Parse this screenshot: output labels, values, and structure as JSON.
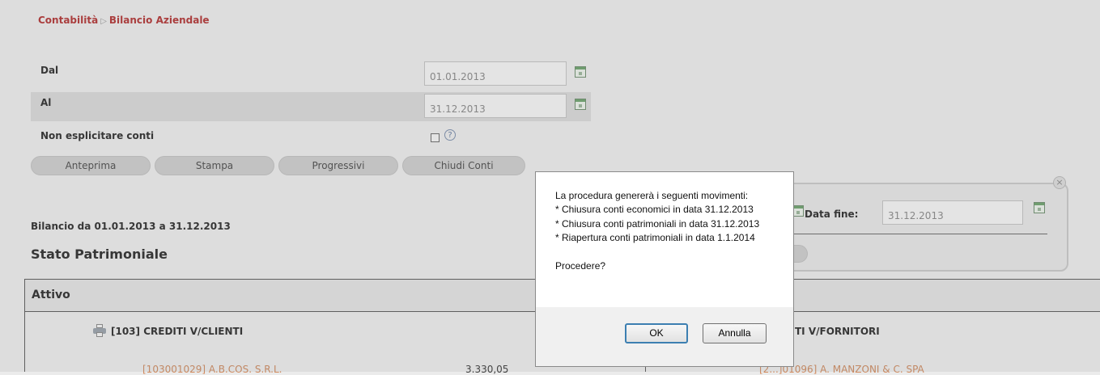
{
  "breadcrumb": {
    "root": "Contabilità",
    "separator": "▷",
    "current": "Bilancio Aziendale"
  },
  "form": {
    "dal_label": "Dal",
    "dal_value": "01.01.2013",
    "al_label": "Al",
    "al_value": "31.12.2013",
    "non_esplicitare_label": "Non esplicitare conti",
    "non_esplicitare_checked": false,
    "help_glyph": "?"
  },
  "buttons": {
    "anteprima": "Anteprima",
    "stampa": "Stampa",
    "progressivi": "Progressivi",
    "chiudi_conti": "Chiudi Conti"
  },
  "report": {
    "range_title": "Bilancio da 01.01.2013 a 31.12.2013",
    "section_title": "Stato Patrimoniale",
    "column_header": "Attivo",
    "left_account_head": "[103] CREDITI V/CLIENTI",
    "left_account_line": "[103001029] A.B.COS. S.R.L.",
    "left_amount": "3.330,05",
    "right_account_head": "TI V/FORNITORI",
    "right_account_line": "[2...]01096] A. MANZONI & C. SPA"
  },
  "side_popup": {
    "data_fine_label": "Data fine:",
    "data_fine_value": "31.12.2013",
    "close_glyph": "×"
  },
  "dialog": {
    "lines": [
      "La procedura genererà i seguenti movimenti:",
      "* Chiusura conti economici in data 31.12.2013",
      "* Chiusura conti patrimoniali in data 31.12.2013",
      "* Riapertura conti patrimoniali in data 1.1.2014",
      "",
      "Procedere?"
    ],
    "ok_label": "OK",
    "cancel_label": "Annulla"
  },
  "colors": {
    "breadcrumb": "#b52b2b",
    "account_link": "#d38a5c",
    "ok_focus": "#3c7fb1"
  },
  "icons": {
    "calendar": "calendar-icon",
    "help": "help-icon",
    "printer": "printer-icon",
    "close": "close-icon"
  }
}
